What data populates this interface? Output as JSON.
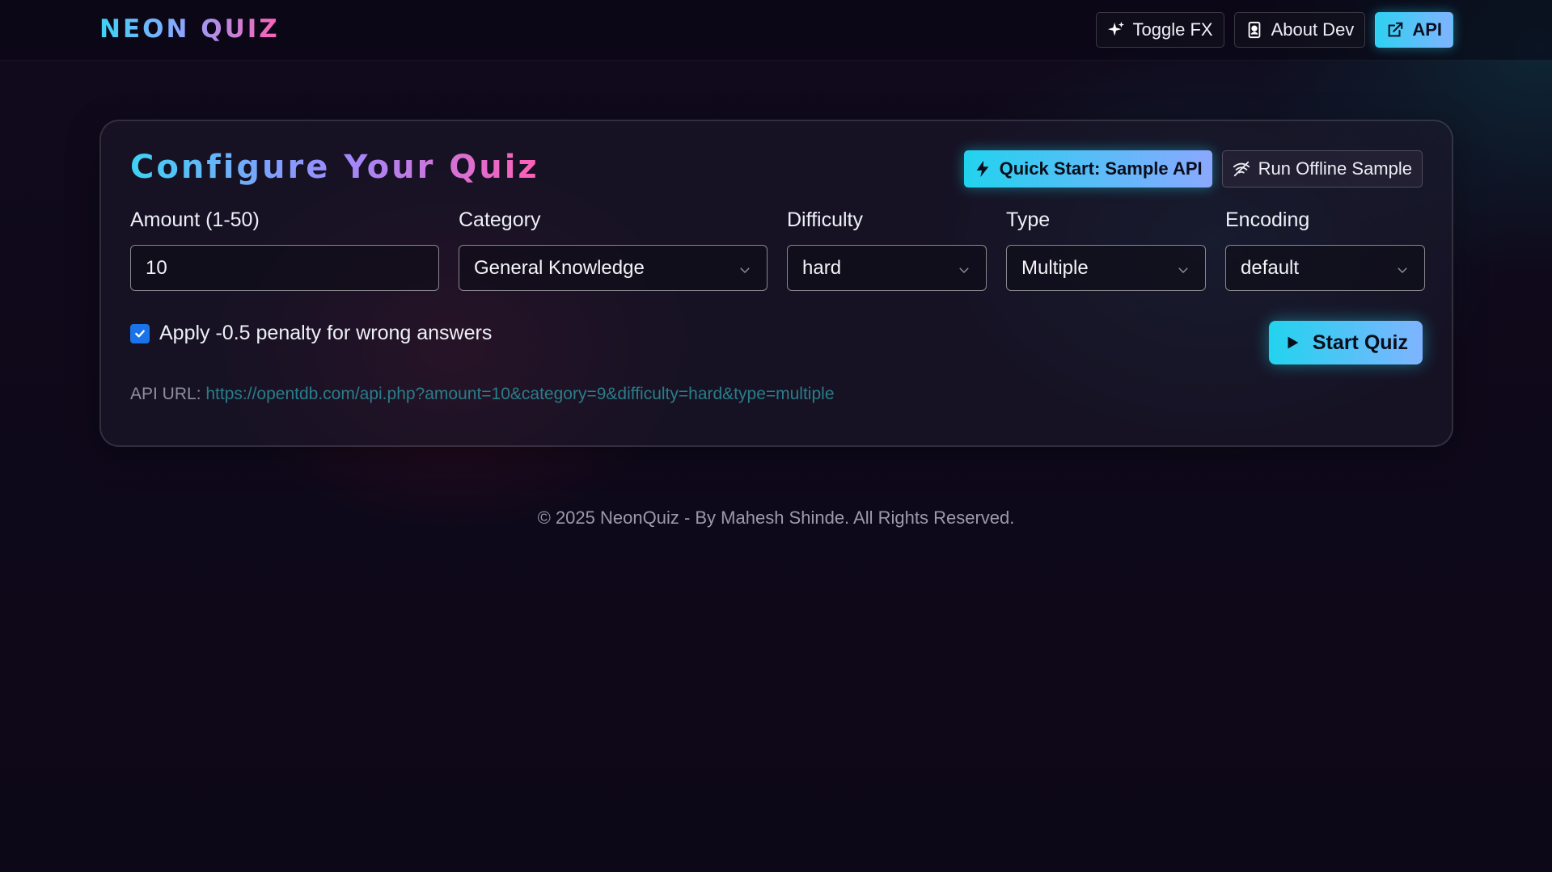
{
  "brand": {
    "name": "NEON QUIZ"
  },
  "nav": {
    "toggle_fx": {
      "label": "Toggle FX",
      "icon": "sparkles-icon"
    },
    "about_dev": {
      "label": "About Dev",
      "icon": "id-badge-icon"
    },
    "api": {
      "label": "API",
      "icon": "external-link-icon"
    }
  },
  "config": {
    "title": "Configure Your Quiz",
    "quick_start": {
      "label": "Quick Start: Sample API",
      "icon": "lightning-icon"
    },
    "offline_sample": {
      "label": "Run Offline Sample",
      "icon": "wifi-off-icon"
    },
    "amount": {
      "label": "Amount (1-50)",
      "value": "10"
    },
    "category": {
      "label": "Category",
      "value": "General Knowledge"
    },
    "difficulty": {
      "label": "Difficulty",
      "value": "hard"
    },
    "type": {
      "label": "Type",
      "value": "Multiple"
    },
    "encoding": {
      "label": "Encoding",
      "value": "default"
    },
    "penalty": {
      "label": "Apply -0.5 penalty for wrong answers",
      "checked": true
    },
    "start": {
      "label": "Start Quiz",
      "icon": "play-icon"
    },
    "api_url": {
      "label": "API URL:",
      "value": "https://opentdb.com/api.php?amount=10&category=9&difficulty=hard&type=multiple"
    }
  },
  "footer": {
    "text": "© 2025 NeonQuiz - By Mahesh Shinde. All Rights Reserved."
  },
  "colors": {
    "accent_cyan": "#22d3ee",
    "accent_pink": "#ff5fb4",
    "checkbox_blue": "#1a73e8",
    "background": "#100a1c"
  }
}
